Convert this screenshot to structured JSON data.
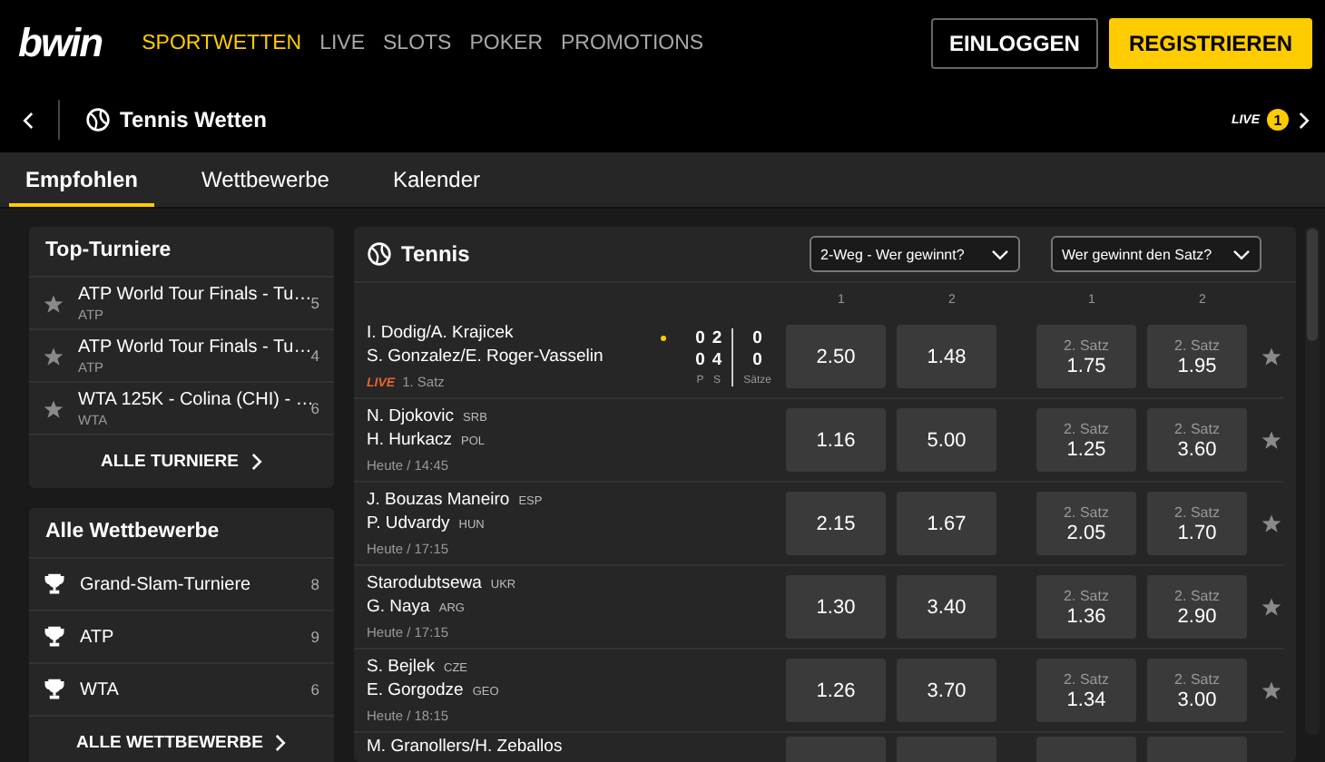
{
  "header": {
    "logo": "bwin",
    "nav": [
      {
        "label": "SPORTWETTEN",
        "selected": true
      },
      {
        "label": "LIVE",
        "selected": false
      },
      {
        "label": "SLOTS",
        "selected": false
      },
      {
        "label": "POKER",
        "selected": false
      },
      {
        "label": "PROMOTIONS",
        "selected": false
      }
    ],
    "buttons": [
      {
        "label": "EINLOGGEN",
        "kind": "outline"
      },
      {
        "label": "REGISTRIEREN",
        "kind": "primary"
      }
    ]
  },
  "subheader": {
    "title": "Tennis Wetten",
    "live_label": "LIVE",
    "live_count": "1"
  },
  "tabs": [
    {
      "label": "Empfohlen",
      "selected": true
    },
    {
      "label": "Wettbewerbe",
      "selected": false
    },
    {
      "label": "Kalender",
      "selected": false
    }
  ],
  "sidebar": {
    "top_tournaments": {
      "title": "Top-Turniere",
      "link": "ALLE TURNIERE",
      "items": [
        {
          "name": "ATP World Tour Finals - Tu…",
          "category": "ATP",
          "count": "5"
        },
        {
          "name": "ATP World Tour Finals - Tu…",
          "category": "ATP",
          "count": "4"
        },
        {
          "name": "WTA 125K - Colina (CHI) - …",
          "category": "WTA",
          "count": "6"
        }
      ]
    },
    "competitions": {
      "title": "Alle Wettbewerbe",
      "link": "ALLE WETTBEWERBE",
      "items": [
        {
          "name": "Grand-Slam-Turniere",
          "count": "8"
        },
        {
          "name": "ATP",
          "count": "9"
        },
        {
          "name": "WTA",
          "count": "6"
        }
      ]
    }
  },
  "events": {
    "title": "Tennis",
    "markets": [
      {
        "label": "2-Weg - Wer gewinnt?"
      },
      {
        "label": "Wer gewinnt den Satz?"
      }
    ],
    "column_labels": [
      "1",
      "2",
      "1",
      "2"
    ],
    "matches": [
      {
        "kind": "live",
        "players": [
          {
            "name": "I. Dodig/A. Krajicek",
            "serving": true
          },
          {
            "name": "S. Gonzalez/E. Roger-Vasselin",
            "serving": false
          }
        ],
        "live_label": "LIVE",
        "status": "1. Satz",
        "score": {
          "labels": [
            "P",
            "S",
            "Sätze"
          ],
          "points": [
            "0",
            "0"
          ],
          "games": [
            "2",
            "4"
          ],
          "sets": [
            "0",
            "0"
          ]
        },
        "odds": [
          "2.50",
          "1.48"
        ],
        "set_odds": [
          {
            "label": "2. Satz",
            "value": "1.75"
          },
          {
            "label": "2. Satz",
            "value": "1.95"
          }
        ]
      },
      {
        "kind": "scheduled",
        "players": [
          {
            "name": "N. Djokovic",
            "country": "SRB"
          },
          {
            "name": "H. Hurkacz",
            "country": "POL"
          }
        ],
        "time": "Heute / 14:45",
        "odds": [
          "1.16",
          "5.00"
        ],
        "set_odds": [
          {
            "label": "2. Satz",
            "value": "1.25"
          },
          {
            "label": "2. Satz",
            "value": "3.60"
          }
        ]
      },
      {
        "kind": "scheduled",
        "players": [
          {
            "name": "J. Bouzas Maneiro",
            "country": "ESP"
          },
          {
            "name": "P. Udvardy",
            "country": "HUN"
          }
        ],
        "time": "Heute / 17:15",
        "odds": [
          "2.15",
          "1.67"
        ],
        "set_odds": [
          {
            "label": "2. Satz",
            "value": "2.05"
          },
          {
            "label": "2. Satz",
            "value": "1.70"
          }
        ]
      },
      {
        "kind": "scheduled",
        "players": [
          {
            "name": "Starodubtsewa",
            "country": "UKR"
          },
          {
            "name": "G. Naya",
            "country": "ARG"
          }
        ],
        "time": "Heute / 17:15",
        "odds": [
          "1.30",
          "3.40"
        ],
        "set_odds": [
          {
            "label": "2. Satz",
            "value": "1.36"
          },
          {
            "label": "2. Satz",
            "value": "2.90"
          }
        ]
      },
      {
        "kind": "scheduled",
        "players": [
          {
            "name": "S. Bejlek",
            "country": "CZE"
          },
          {
            "name": "E. Gorgodze",
            "country": "GEO"
          }
        ],
        "time": "Heute / 18:15",
        "odds": [
          "1.26",
          "3.70"
        ],
        "set_odds": [
          {
            "label": "2. Satz",
            "value": "1.34"
          },
          {
            "label": "2. Satz",
            "value": "3.00"
          }
        ]
      },
      {
        "kind": "partial",
        "players": [
          {
            "name": "M. Granollers/H. Zeballos"
          }
        ]
      }
    ]
  }
}
